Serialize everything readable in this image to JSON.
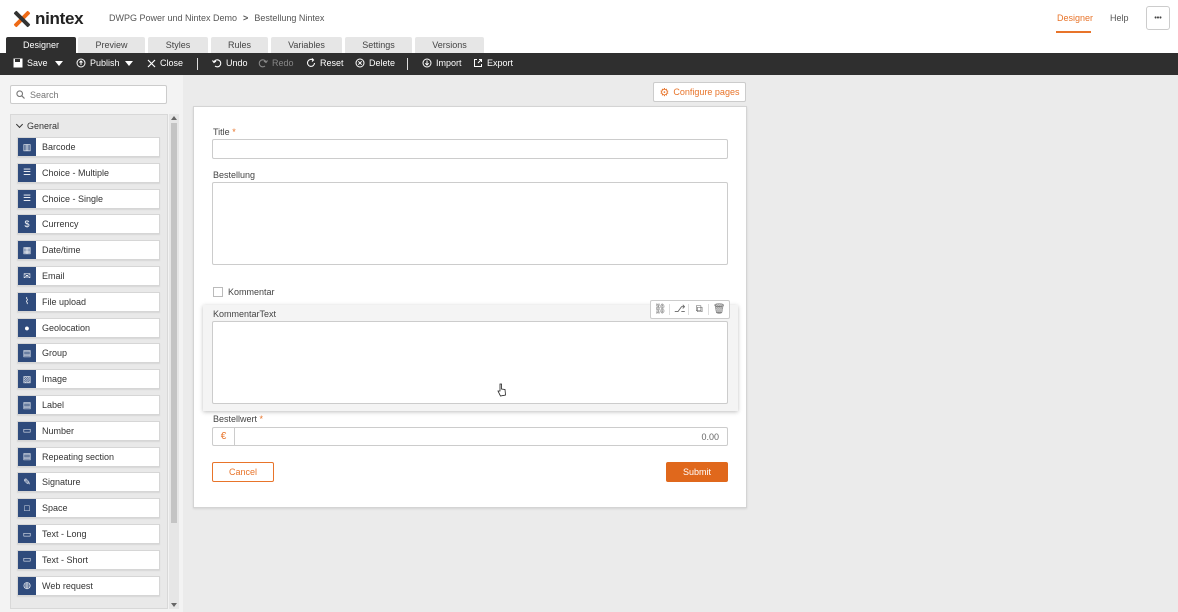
{
  "header": {
    "logo_text": "nintex",
    "breadcrumb": [
      "DWPG Power und Nintex Demo",
      "Bestellung Nintex"
    ],
    "breadcrumb_sep": ">",
    "links": {
      "designer": "Designer",
      "help": "Help"
    },
    "more": "•••",
    "accent": "#e8742a"
  },
  "tabs": [
    "Designer",
    "Preview",
    "Styles",
    "Rules",
    "Variables",
    "Settings",
    "Versions"
  ],
  "toolbar": {
    "save": "Save",
    "publish": "Publish",
    "close": "Close",
    "undo": "Undo",
    "redo": "Redo",
    "reset": "Reset",
    "delete": "Delete",
    "import": "Import",
    "export": "Export"
  },
  "sidebar": {
    "search_placeholder": "Search",
    "group": "General",
    "controls": [
      {
        "label": "Barcode",
        "icon": "barcode-icon"
      },
      {
        "label": "Choice - Multiple",
        "icon": "choice-multiple-icon"
      },
      {
        "label": "Choice - Single",
        "icon": "choice-single-icon"
      },
      {
        "label": "Currency",
        "icon": "currency-icon"
      },
      {
        "label": "Date/time",
        "icon": "calendar-icon"
      },
      {
        "label": "Email",
        "icon": "email-icon"
      },
      {
        "label": "File upload",
        "icon": "paperclip-icon"
      },
      {
        "label": "Geolocation",
        "icon": "location-pin-icon"
      },
      {
        "label": "Group",
        "icon": "group-icon"
      },
      {
        "label": "Image",
        "icon": "image-icon"
      },
      {
        "label": "Label",
        "icon": "label-icon"
      },
      {
        "label": "Number",
        "icon": "number-icon"
      },
      {
        "label": "Repeating section",
        "icon": "repeating-section-icon"
      },
      {
        "label": "Signature",
        "icon": "signature-icon"
      },
      {
        "label": "Space",
        "icon": "space-icon"
      },
      {
        "label": "Text - Long",
        "icon": "text-long-icon"
      },
      {
        "label": "Text - Short",
        "icon": "text-short-icon"
      },
      {
        "label": "Web request",
        "icon": "globe-icon"
      }
    ]
  },
  "canvas": {
    "configure_pages": "Configure pages",
    "fields": {
      "title_label": "Title",
      "required_mark": "*",
      "bestellung_label": "Bestellung",
      "kommentar_label": "Kommentar",
      "kommentartext_label": "KommentarText",
      "bestellwert_label": "Bestellwert",
      "currency_symbol": "€",
      "bestellwert_value": "0.00"
    },
    "cancel": "Cancel",
    "submit": "Submit"
  }
}
